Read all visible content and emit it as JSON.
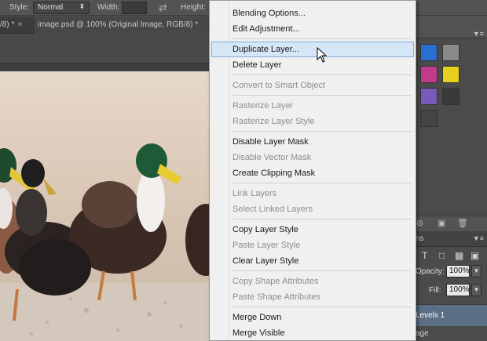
{
  "options_bar": {
    "style_label": "Style:",
    "style_value": "Normal",
    "width_label": "Width:",
    "height_label": "Height:"
  },
  "tabs": [
    {
      "label": "/8) *"
    },
    {
      "label": "image.psd @ 100% (Original Image, RGB/8) *"
    }
  ],
  "context_menu": {
    "groups": [
      [
        {
          "label": "Blending Options...",
          "enabled": true
        },
        {
          "label": "Edit Adjustment...",
          "enabled": true
        }
      ],
      [
        {
          "label": "Duplicate Layer...",
          "enabled": true,
          "highlighted": true
        },
        {
          "label": "Delete Layer",
          "enabled": true
        }
      ],
      [
        {
          "label": "Convert to Smart Object",
          "enabled": false
        }
      ],
      [
        {
          "label": "Rasterize Layer",
          "enabled": false
        },
        {
          "label": "Rasterize Layer Style",
          "enabled": false
        }
      ],
      [
        {
          "label": "Disable Layer Mask",
          "enabled": true
        },
        {
          "label": "Disable Vector Mask",
          "enabled": false
        },
        {
          "label": "Create Clipping Mask",
          "enabled": true
        }
      ],
      [
        {
          "label": "Link Layers",
          "enabled": false
        },
        {
          "label": "Select Linked Layers",
          "enabled": false
        }
      ],
      [
        {
          "label": "Copy Layer Style",
          "enabled": true
        },
        {
          "label": "Paste Layer Style",
          "enabled": false
        },
        {
          "label": "Clear Layer Style",
          "enabled": true
        }
      ],
      [
        {
          "label": "Copy Shape Attributes",
          "enabled": false
        },
        {
          "label": "Paste Shape Attributes",
          "enabled": false
        }
      ],
      [
        {
          "label": "Merge Down",
          "enabled": true
        },
        {
          "label": "Merge Visible",
          "enabled": true
        }
      ]
    ]
  },
  "layers_panel": {
    "tab_label": "ns",
    "opacity_label": "Opacity:",
    "opacity_value": "100%",
    "fill_label": "Fill:",
    "fill_value": "100%",
    "selected_layer": "Levels 1",
    "next_layer": "age"
  },
  "colors": {
    "menu_highlight": "#d5e6f7",
    "menu_highlight_border": "#84acdd",
    "disabled_text": "#8e8e8e",
    "selected_layer": "#5a6e84"
  }
}
